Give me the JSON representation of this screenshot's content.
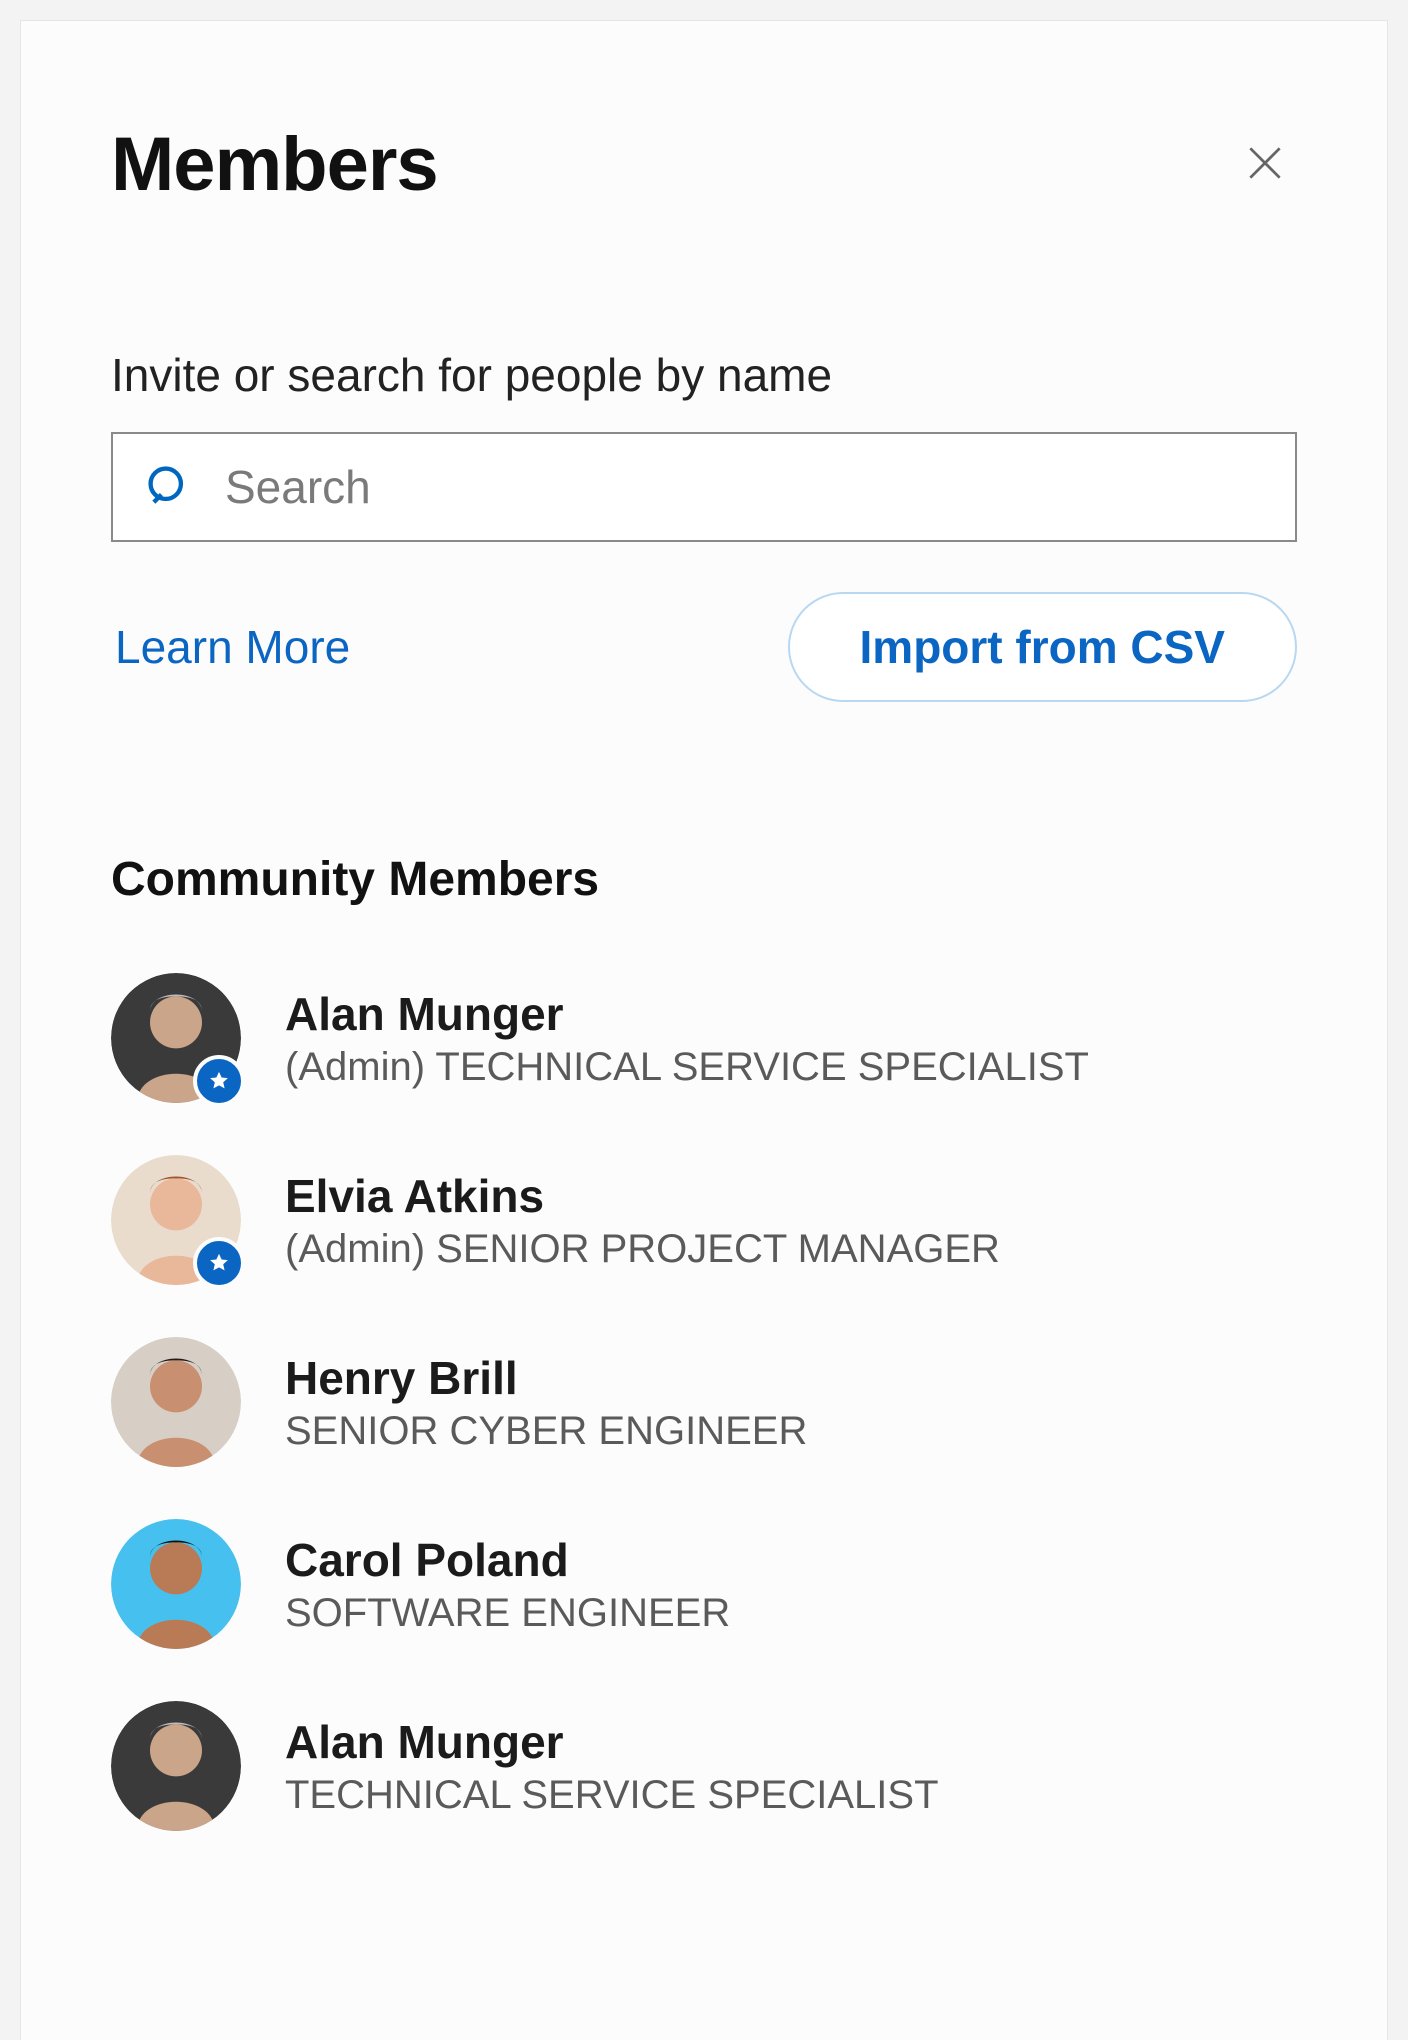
{
  "panel": {
    "title": "Members",
    "invite_label": "Invite or search for people by name",
    "search_placeholder": "Search",
    "learn_more": "Learn More",
    "import_csv": "Import from CSV",
    "section_title": "Community Members"
  },
  "members": [
    {
      "name": "Alan Munger",
      "subtitle": "(Admin) TECHNICAL SERVICE SPECIALIST",
      "admin": true,
      "avatar_bg": "#3a3a3a",
      "avatar_skin": "#caa58a",
      "avatar_hair": "#bdbdbd"
    },
    {
      "name": "Elvia Atkins",
      "subtitle": "(Admin) SENIOR PROJECT MANAGER",
      "admin": true,
      "avatar_bg": "#e9dccd",
      "avatar_skin": "#e9b79a",
      "avatar_hair": "#a0522d"
    },
    {
      "name": "Henry Brill",
      "subtitle": "SENIOR CYBER ENGINEER",
      "admin": false,
      "avatar_bg": "#d7cfc6",
      "avatar_skin": "#c89070",
      "avatar_hair": "#1c1c1c"
    },
    {
      "name": "Carol Poland",
      "subtitle": "SOFTWARE ENGINEER",
      "admin": false,
      "avatar_bg": "#46c0ee",
      "avatar_skin": "#b97b55",
      "avatar_hair": "#111111"
    },
    {
      "name": "Alan Munger",
      "subtitle": "TECHNICAL SERVICE SPECIALIST",
      "admin": false,
      "avatar_bg": "#3a3a3a",
      "avatar_skin": "#caa58a",
      "avatar_hair": "#bdbdbd"
    }
  ]
}
